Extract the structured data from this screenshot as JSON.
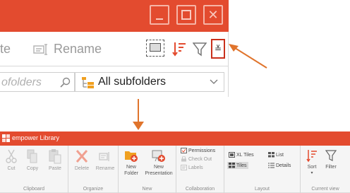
{
  "zoom": {
    "ribbon": {
      "delete_fragment": "te",
      "rename_label": "Rename"
    },
    "search": {
      "placeholder_fragment": "ofolders"
    },
    "scope": {
      "label": "All subfolders"
    }
  },
  "app": {
    "title": "empower Library",
    "groups": {
      "clipboard": {
        "label": "Clipboard",
        "cut": "Cut",
        "copy": "Copy",
        "paste": "Paste"
      },
      "organize": {
        "label": "Organize",
        "delete": "Delete",
        "rename": "Rename"
      },
      "new": {
        "label": "New",
        "new_folder_line1": "New",
        "new_folder_line2": "Folder",
        "new_presentation_line1": "New",
        "new_presentation_line2": "Presentation"
      },
      "collaboration": {
        "label": "Collaboration",
        "permissions": "Permissions",
        "check_out": "Check Out",
        "labels": "Labels"
      },
      "layout": {
        "label": "Layout",
        "xl_tiles": "XL Tiles",
        "list": "List",
        "tiles": "Tiles",
        "details": "Details"
      },
      "current_view": {
        "label": "Current view",
        "sort": "Sort",
        "filter": "Filter"
      }
    }
  },
  "colors": {
    "titlebar": "#e34b2f",
    "highlight_border": "#c9301c",
    "arrow": "#e0742c",
    "icon_red": "#e34b2f",
    "icon_orange": "#f0a020"
  }
}
